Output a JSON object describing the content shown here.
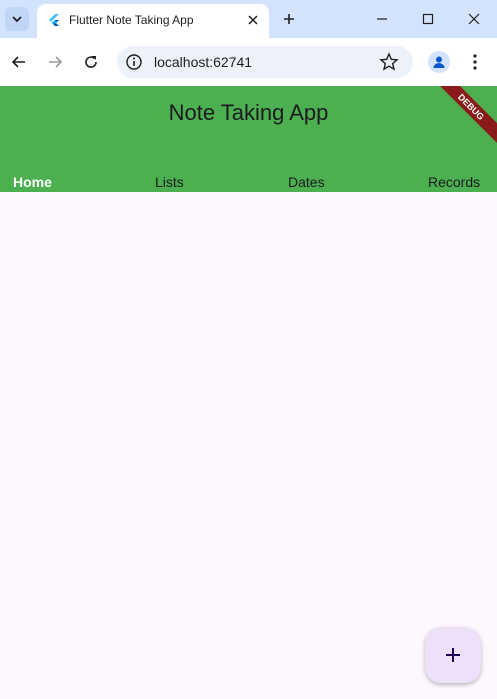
{
  "browser": {
    "tab_title": "Flutter Note Taking App",
    "url": "localhost:62741"
  },
  "app": {
    "title": "Note Taking App",
    "debug_label": "DEBUG",
    "tabs": [
      {
        "label": "Home",
        "active": true
      },
      {
        "label": "Lists",
        "active": false
      },
      {
        "label": "Dates",
        "active": false
      },
      {
        "label": "Records",
        "active": false
      }
    ],
    "fab_icon": "plus-icon"
  },
  "colors": {
    "app_bar": "#4caf50",
    "background": "#fdf7fe",
    "fab": "#ece1f8",
    "debug": "#8b1a1a"
  }
}
